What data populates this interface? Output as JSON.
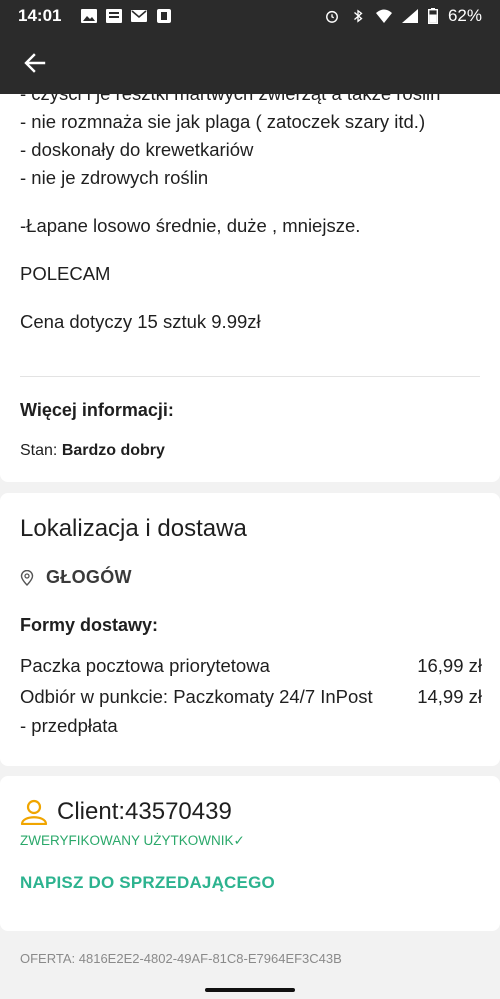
{
  "status_bar": {
    "time": "14:01",
    "battery": "62%",
    "icons": [
      "image-icon",
      "news-icon",
      "mail-icon",
      "app-icon",
      "alarm-icon",
      "bluetooth-icon",
      "wifi-icon",
      "signal-icon",
      "battery-icon"
    ]
  },
  "appbar": {
    "back_icon": "arrow-left-icon"
  },
  "description": {
    "clipped_line": "- czyści i je resztki martwych zwierząt a także roślin",
    "lines": [
      "- nie rozmnaża sie jak plaga ( zatoczek szary itd.)",
      "- doskonały do krewetkariów",
      "- nie je zdrowych roślin"
    ],
    "p1": "-Łapane losowo średnie, duże , mniejsze.",
    "p2": "POLECAM",
    "p3": "Cena dotyczy 15 sztuk 9.99zł"
  },
  "more_info": {
    "title": "Więcej informacji:",
    "condition_label": "Stan:",
    "condition_value": "Bardzo dobry"
  },
  "location": {
    "title": "Lokalizacja i dostawa",
    "city": "GŁOGÓW",
    "delivery_title": "Formy dostawy:",
    "options": [
      {
        "name": "Paczka pocztowa priorytetowa",
        "price": "16,99 zł"
      },
      {
        "name": "Odbiór w punkcie: Paczkomaty 24/7 InPost",
        "price": "14,99 zł"
      }
    ],
    "option2_cont": "- przedpłata"
  },
  "seller": {
    "name": "Client:43570439",
    "verified": "ZWERYFIKOWANY UŻYTKOWNIK",
    "verified_mark": "✓",
    "contact": "NAPISZ DO SPRZEDAJĄCEGO"
  },
  "offer_id": "OFERTA: 4816E2E2-4802-49AF-81C8-E7964EF3C43B",
  "colors": {
    "bar": "#2b2b2b",
    "accent": "#2db38f",
    "verified": "#2aa86a",
    "user_icon": "#f0a500"
  }
}
